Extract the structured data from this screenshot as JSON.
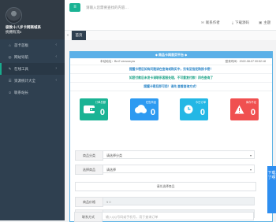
{
  "sidebar": {
    "user_name": "极致十八岁卡网商城系",
    "user_sub": "统拥有流x",
    "items": [
      {
        "label": "首卡首板",
        "icon": "home-icon",
        "chevron": "‹"
      },
      {
        "label": "网站导航",
        "icon": "compass-icon",
        "chevron": "‹"
      },
      {
        "label": "在线工具",
        "icon": "wrench-icon",
        "chevron": "›"
      },
      {
        "label": "资源统计大全",
        "icon": "list-icon",
        "chevron": "‹"
      },
      {
        "label": "联系站长",
        "icon": "user-icon",
        "chevron": ""
      }
    ]
  },
  "topbar": {
    "menu_icon": "≡",
    "search_placeholder": "请输入您需要查找的内容…"
  },
  "subbar": {
    "items": [
      {
        "label": "联系作者",
        "icon": "chat-icon"
      },
      {
        "label": "下载源码",
        "icon": "download-icon"
      },
      {
        "label": "主题",
        "icon": "theme-icon"
      }
    ]
  },
  "tabs": {
    "home": "首页"
  },
  "panel": {
    "title": "◆ 商品卡网首页平台 ◆",
    "address_label": "本站地址：",
    "address": "Bro7.veuvow.pw",
    "login_label": "登录时间：",
    "login": "2022-08-07 00:52:18",
    "notice1": "提醒卡密后如有问题请在查询或购买中，另有至指定购换卡密！",
    "notice2": "如您付款后未发卡请联系客服处理，不可重复付款！四色查询了",
    "notice3": "提醒卡密后即可用！请先 查看查询方式！"
  },
  "cards": [
    {
      "label": "订单总额",
      "value": "0",
      "color": "#1ab394",
      "icon": "wallet-icon"
    },
    {
      "label": "在售商品",
      "value": "0",
      "color": "#2d9af1",
      "icon": "cloud-icon"
    },
    {
      "label": "今日订单",
      "value": "0",
      "color": "#23b7e5",
      "icon": "clock-icon"
    },
    {
      "label": "库存不足",
      "value": "0",
      "color": "#f05050",
      "icon": "warning-icon"
    }
  ],
  "form": {
    "category_label": "商品分类",
    "category_value": "请选择分类",
    "goods_label": "选择商品",
    "goods_value": "请选择",
    "prompt": "请先选择商品",
    "price_label": "商品价格",
    "price_value": "¥ 0",
    "stock_label": "库存数量",
    "stock_value": "0",
    "contact_label": "联系方式",
    "contact_placeholder": "输入QQ号码或手机号，用于查询订单"
  },
  "float_button": {
    "label": "下载了啊"
  }
}
